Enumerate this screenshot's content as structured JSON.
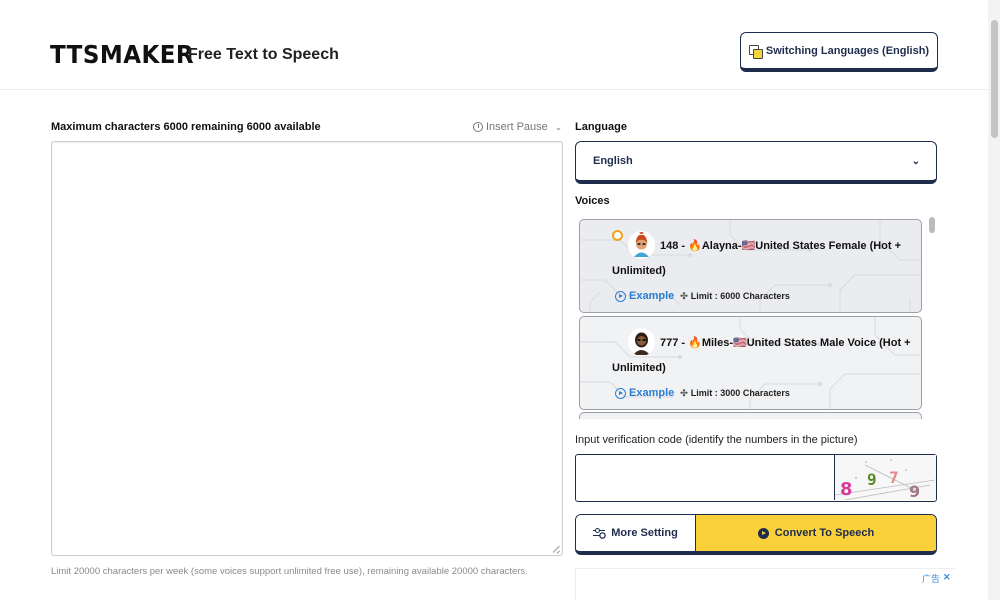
{
  "header": {
    "logo": "TTSMAKER",
    "tagline": "Free Text to Speech",
    "switch_language_label": "Switching Languages (English)"
  },
  "editor": {
    "max_chars_label": "Maximum characters 6000 remaining 6000 available",
    "insert_pause_label": "Insert Pause",
    "text_value": "",
    "limit_note": "Limit 20000 characters per week (some voices support unlimited free use), remaining available 20000 characters."
  },
  "language": {
    "label": "Language",
    "selected": "English"
  },
  "voices": {
    "label": "Voices",
    "items": [
      {
        "title": "148 - 🔥Alayna-🇺🇸United States Female (Hot + Unlimited)",
        "example_label": "Example",
        "limit_label": "Limit : 6000 Characters",
        "selected": true
      },
      {
        "title": "777 - 🔥Miles-🇺🇸United States Male Voice (Hot + Unlimited)",
        "example_label": "Example",
        "limit_label": "Limit : 3000 Characters",
        "selected": false
      }
    ]
  },
  "verification": {
    "label": "Input verification code (identify the numbers in the picture)",
    "value": "",
    "captcha_digits": [
      "8",
      "9",
      "7",
      "9"
    ]
  },
  "actions": {
    "more_setting_label": "More Setting",
    "convert_label": "Convert To Speech"
  },
  "ad": {
    "badge": "广告",
    "close": "✕"
  },
  "colors": {
    "accent_yellow": "#fbd13a",
    "navy": "#1f2d4d",
    "link_blue": "#2a7ed2",
    "radio_orange": "#f2a21b"
  }
}
